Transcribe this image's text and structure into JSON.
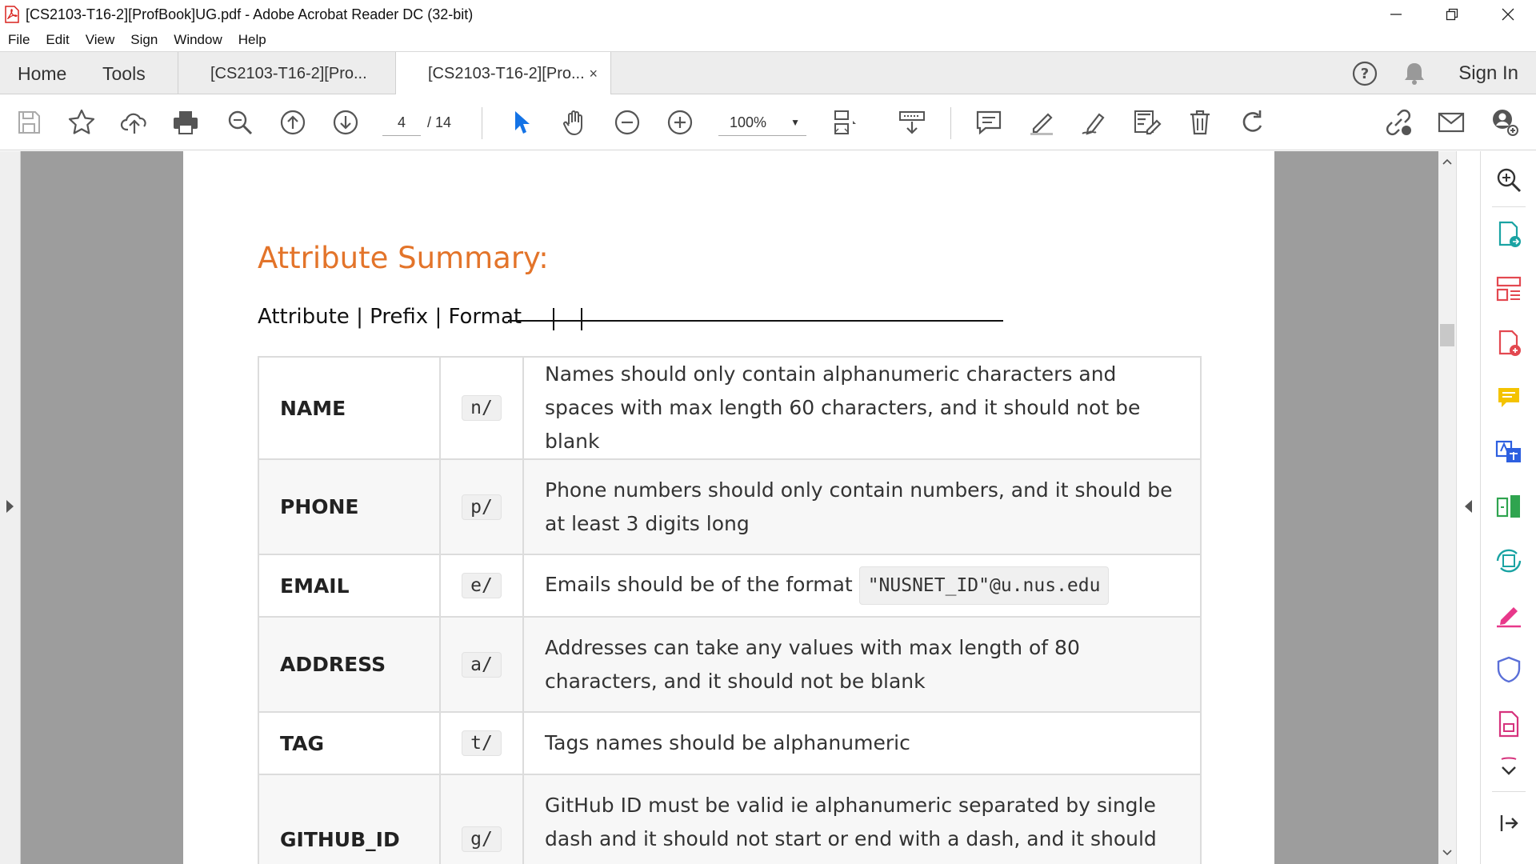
{
  "window": {
    "title": "[CS2103-T16-2][ProfBook]UG.pdf - Adobe Acrobat Reader DC (32-bit)"
  },
  "menu": [
    "File",
    "Edit",
    "View",
    "Sign",
    "Window",
    "Help"
  ],
  "tabs": {
    "home": "Home",
    "tools": "Tools",
    "doc_tab_1": "[CS2103-T16-2][Pro...",
    "doc_tab_2": "[CS2103-T16-2][Pro...",
    "close": "×",
    "sign_in": "Sign In"
  },
  "toolbar": {
    "current_page": "4",
    "page_total": "/ 14",
    "zoom": "100%"
  },
  "document": {
    "heading": "Attribute Summary:",
    "subline": "Attribute | Prefix | Format",
    "rows": [
      {
        "attribute": "NAME",
        "prefix": "n/",
        "format": "Names should only contain alphanumeric characters and spaces with max length 60 characters, and it should not be blank"
      },
      {
        "attribute": "PHONE",
        "prefix": "p/",
        "format": "Phone numbers should only contain numbers, and it should be at least 3 digits long"
      },
      {
        "attribute": "EMAIL",
        "prefix": "e/",
        "format": "Emails should be of the format",
        "format_code": "\"NUSNET_ID\"@u.nus.edu"
      },
      {
        "attribute": "ADDRESS",
        "prefix": "a/",
        "format": "Addresses can take any values with max length of 80 characters, and it should not be blank"
      },
      {
        "attribute": "TAG",
        "prefix": "t/",
        "format": "Tags names should be alphanumeric"
      },
      {
        "attribute": "GITHUB_ID",
        "prefix": "g/",
        "format": "GitHub ID must be valid ie alphanumeric separated by single dash and it should not start or end with a dash, and it should not be blank"
      }
    ]
  },
  "colors": {
    "heading": "#e3742a",
    "accent_blue": "#1473e6",
    "viewport_bg": "#9d9d9d"
  },
  "icons": {
    "toolbar": [
      "save-icon",
      "bookmark-star-icon",
      "upload-cloud-icon",
      "print-icon",
      "zoom-search-icon",
      "prev-page-icon",
      "next-page-icon",
      "select-cursor-icon",
      "hand-tool-icon",
      "zoom-out-icon",
      "zoom-in-icon",
      "page-fit-icon",
      "scroll-mode-icon",
      "comment-icon",
      "highlight-pen-icon",
      "sign-pen-icon",
      "edit-text-icon",
      "delete-icon",
      "rotate-icon",
      "share-link-icon",
      "email-icon",
      "add-user-icon"
    ],
    "right_panel": [
      "search-zoom-icon",
      "export-pdf-icon",
      "organize-pages-icon",
      "create-pdf-icon",
      "comment-icon",
      "translate-icon",
      "compress-pdf-icon",
      "edit-send-icon",
      "fill-sign-icon",
      "protect-icon",
      "document-icon",
      "more-tools-chevron-icon",
      "collapse-panel-icon"
    ]
  }
}
